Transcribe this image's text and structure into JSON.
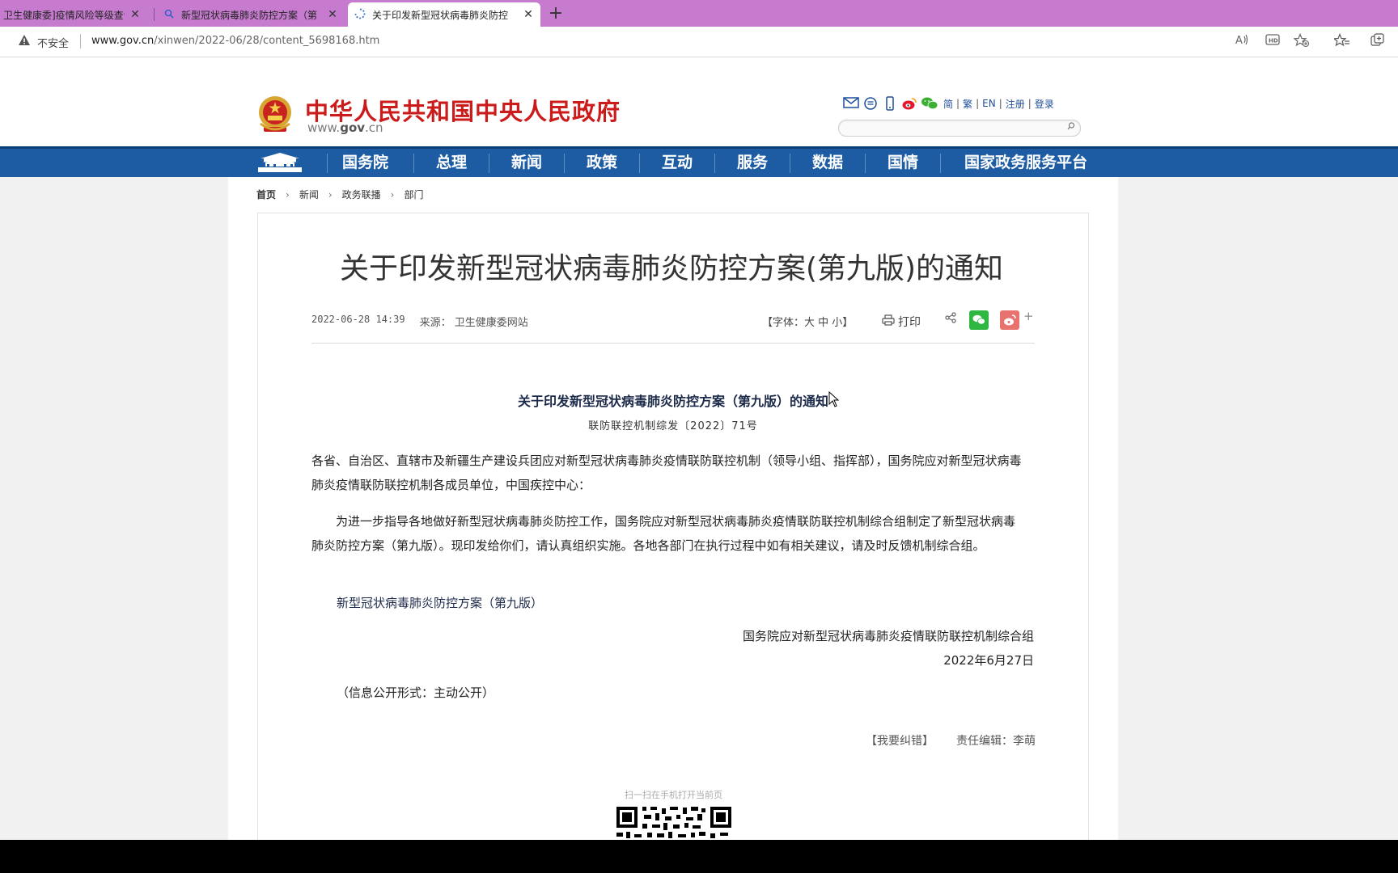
{
  "browser": {
    "tabs": [
      {
        "title": "卫生健康委]疫情风险等级查询_",
        "close": "✕"
      },
      {
        "title": "新型冠状病毒肺炎防控方案（第",
        "close": "✕"
      },
      {
        "title": "关于印发新型冠状病毒肺炎防控",
        "close": "✕"
      }
    ],
    "new_tab": "+",
    "security_label": "不安全",
    "url_host": "www.gov.cn",
    "url_path": "/xinwen/2022-06/28/content_5698168.htm",
    "accent": "#c67bcf"
  },
  "header": {
    "site_title": "中华人民共和国中央人民政府",
    "site_domain_prefix": "www.",
    "site_domain_main": "gov",
    "site_domain_suffix": ".cn",
    "links": [
      "简",
      "繁",
      "EN",
      "注册",
      "登录"
    ],
    "search_placeholder": ""
  },
  "nav": {
    "items": [
      "国务院",
      "总理",
      "新闻",
      "政策",
      "互动",
      "服务",
      "数据",
      "国情",
      "国家政务服务平台"
    ],
    "color": "#1d5ca3"
  },
  "breadcrumb": [
    "首页",
    "新闻",
    "政务联播",
    "部门"
  ],
  "article": {
    "title": "关于印发新型冠状病毒肺炎防控方案(第九版)的通知",
    "date": "2022-06-28 14:39",
    "source": "来源： 卫生健康委网站",
    "font_size_control": "【字体：大  中  小】",
    "print": "打印",
    "doc_title": "关于印发新型冠状病毒肺炎防控方案（第九版）的通知",
    "doc_number": "联防联控机制综发〔2022〕71号",
    "para1": "各省、自治区、直辖市及新疆生产建设兵团应对新型冠状病毒肺炎疫情联防联控机制（领导小组、指挥部），国务院应对新型冠状病毒肺炎疫情联防联控机制各成员单位，中国疾控中心：",
    "para2": "为进一步指导各地做好新型冠状病毒肺炎防控工作，国务院应对新型冠状病毒肺炎疫情联防联控机制综合组制定了新型冠状病毒肺炎防控方案（第九版）。现印发给你们，请认真组织实施。各地各部门在执行过程中如有相关建议，请及时反馈机制综合组。",
    "attachment": "新型冠状病毒肺炎防控方案（第九版）",
    "signer": "国务院应对新型冠状病毒肺炎疫情联防联控机制综合组",
    "sign_date": "2022年6月27日",
    "disclosure": "（信息公开形式：主动公开）",
    "correction": "【我要纠错】",
    "editor": "责任编辑：李萌",
    "qr_caption": "扫一扫在手机打开当前页"
  }
}
